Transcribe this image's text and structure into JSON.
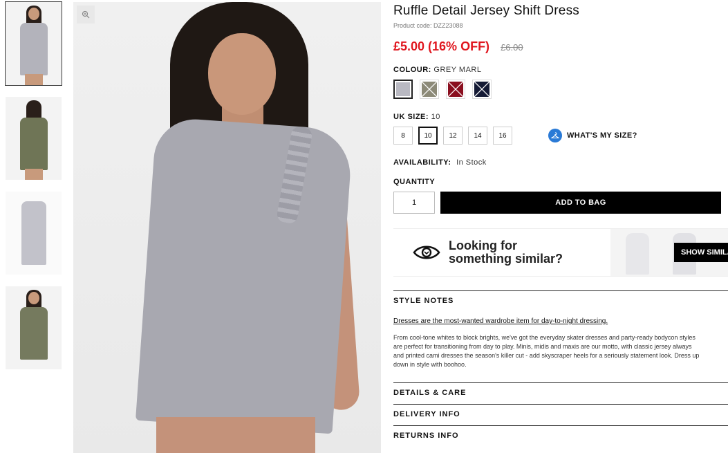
{
  "product": {
    "title": "Ruffle Detail Jersey Shift Dress",
    "product_code": "Product code: DZZ23088",
    "price": "£5.00 (16% OFF)",
    "old_price": "£6.00"
  },
  "colour": {
    "label": "COLOUR:",
    "selected": "GREY MARL",
    "swatches": [
      {
        "name": "grey-marl",
        "color": "#b9b9c2",
        "selected": true
      },
      {
        "name": "khaki",
        "color": "#8c8a78",
        "selected": false
      },
      {
        "name": "burgundy",
        "color": "#8a0e1e",
        "selected": false
      },
      {
        "name": "navy",
        "color": "#141a35",
        "selected": false
      }
    ]
  },
  "size": {
    "label": "UK SIZE:",
    "selected": "10",
    "options": [
      "8",
      "10",
      "12",
      "14",
      "16"
    ],
    "guide_label": "WHAT'S MY SIZE?"
  },
  "availability": {
    "label": "AVAILABILITY:",
    "value": "In Stock"
  },
  "quantity": {
    "label": "QUANTITY",
    "value": "1",
    "add_label": "ADD TO BAG",
    "side_char": "("
  },
  "similar": {
    "line1": "Looking for",
    "line2": "something similar?",
    "button": "SHOW SIMILAR"
  },
  "style_notes": {
    "heading": "STYLE NOTES",
    "lead": "Dresses are the most-wanted wardrobe item for day-to-night dressing.",
    "body": [
      "From cool-tone whites to block brights, we've got the everyday skater dresses and party-ready bodycon styles",
      "are perfect for transitioning from day to play. Minis, midis and maxis are our motto, with classic jersey always",
      "and printed cami dresses the season's killer cut - add skyscraper heels for a seriously statement look. Dress up",
      "down in style with boohoo."
    ]
  },
  "accordions": [
    "DETAILS & CARE",
    "DELIVERY INFO",
    "RETURNS INFO"
  ],
  "thumbnails": [
    {
      "name": "thumb-grey-front",
      "dress": "#b3b3bb"
    },
    {
      "name": "thumb-khaki-back",
      "dress": "#6f7556"
    },
    {
      "name": "thumb-grey-flat",
      "dress": "#c2c2ca"
    },
    {
      "name": "thumb-khaki-front",
      "dress": "#757a5e"
    }
  ],
  "colors": {
    "price_red": "#e0171f",
    "button_black": "#000000",
    "size_icon_blue": "#2a7ad6"
  }
}
